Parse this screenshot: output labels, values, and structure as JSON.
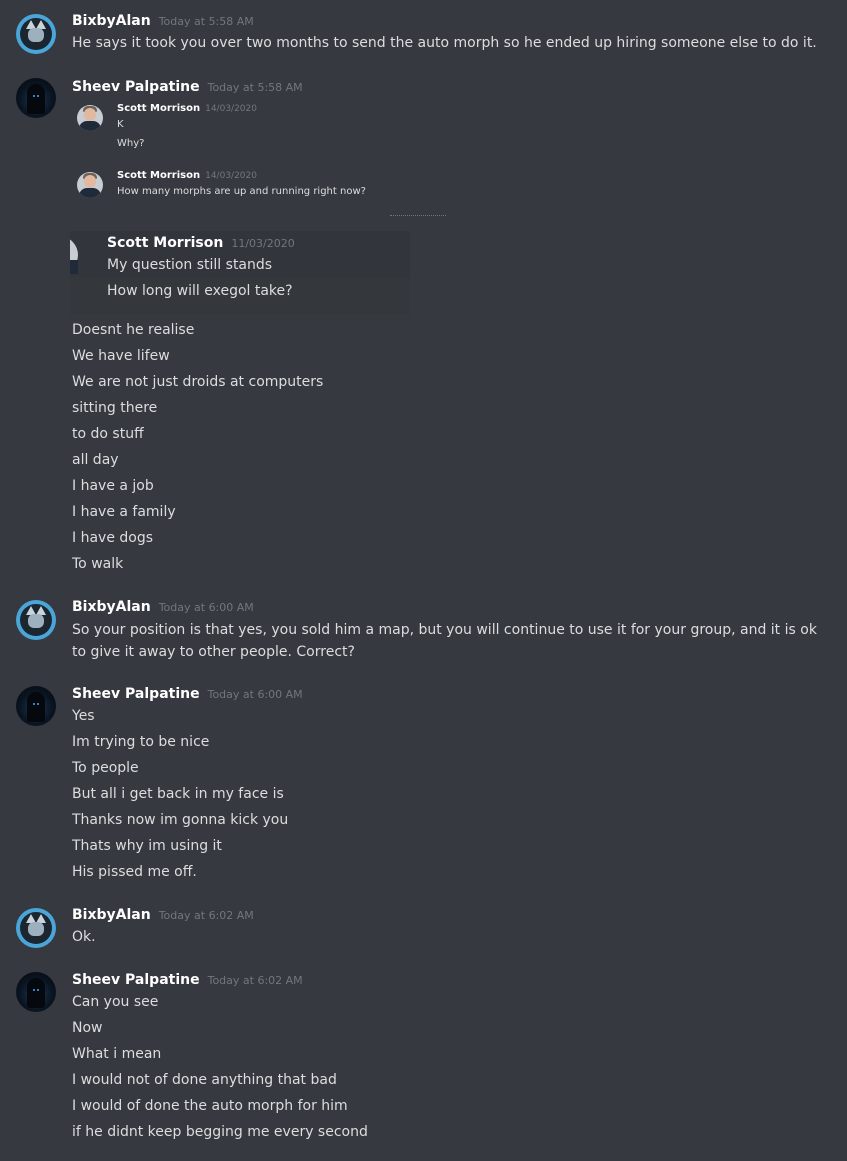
{
  "messages": [
    {
      "author": "BixbyAlan",
      "time": "Today at 5:58 AM",
      "lines": [
        "He says it took you over two months to send the auto morph so he ended up hiring someone else to do it."
      ]
    },
    {
      "author": "Sheev Palpatine",
      "time": "Today at 5:58 AM",
      "embedded_screenshot": {
        "messages": [
          {
            "author": "Scott Morrison",
            "time": "14/03/2020",
            "lines": [
              "K",
              "Why?"
            ]
          },
          {
            "author": "Scott Morrison",
            "time": "14/03/2020",
            "lines": [
              "How many morphs are up and running right now?"
            ]
          }
        ]
      },
      "embedded_screenshot_2": {
        "author": "Scott Morrison",
        "time": "11/03/2020",
        "lines": [
          "My question still stands",
          "How long will exegol take?"
        ]
      },
      "lines": [
        "Doesnt he realise",
        "We have lifew",
        "We are not just droids at computers",
        "sitting there",
        "to do stuff",
        "all day",
        "I have a job",
        "I have a family",
        "I have dogs",
        "To walk"
      ]
    },
    {
      "author": "BixbyAlan",
      "time": "Today at 6:00 AM",
      "lines": [
        "So your position is that yes, you sold him a map, but you will continue to use it for your group, and it is ok to give it away to other people. Correct?"
      ]
    },
    {
      "author": "Sheev Palpatine",
      "time": "Today at 6:00 AM",
      "lines": [
        "Yes",
        "Im trying to be nice",
        "To people",
        "But all i get back in my face is",
        "Thanks now im gonna kick you",
        "Thats why im using it",
        "His pissed me off."
      ]
    },
    {
      "author": "BixbyAlan",
      "time": "Today at 6:02 AM",
      "lines": [
        "Ok."
      ]
    },
    {
      "author": "Sheev Palpatine",
      "time": "Today at 6:02 AM",
      "lines": [
        "Can you see",
        "Now",
        "What i mean",
        "I would not of done anything that bad",
        "I would of done the auto morph for him",
        "if he didnt keep begging me every second"
      ]
    }
  ],
  "icons": {
    "bixby_avatar": "cat-avatar-icon",
    "sheev_avatar": "hooded-figure-avatar-icon",
    "scott_avatar": "person-avatar-icon"
  },
  "colors": {
    "background": "#36393f",
    "username": "#ffffff",
    "timestamp": "#72767d",
    "text": "#dcddde"
  }
}
